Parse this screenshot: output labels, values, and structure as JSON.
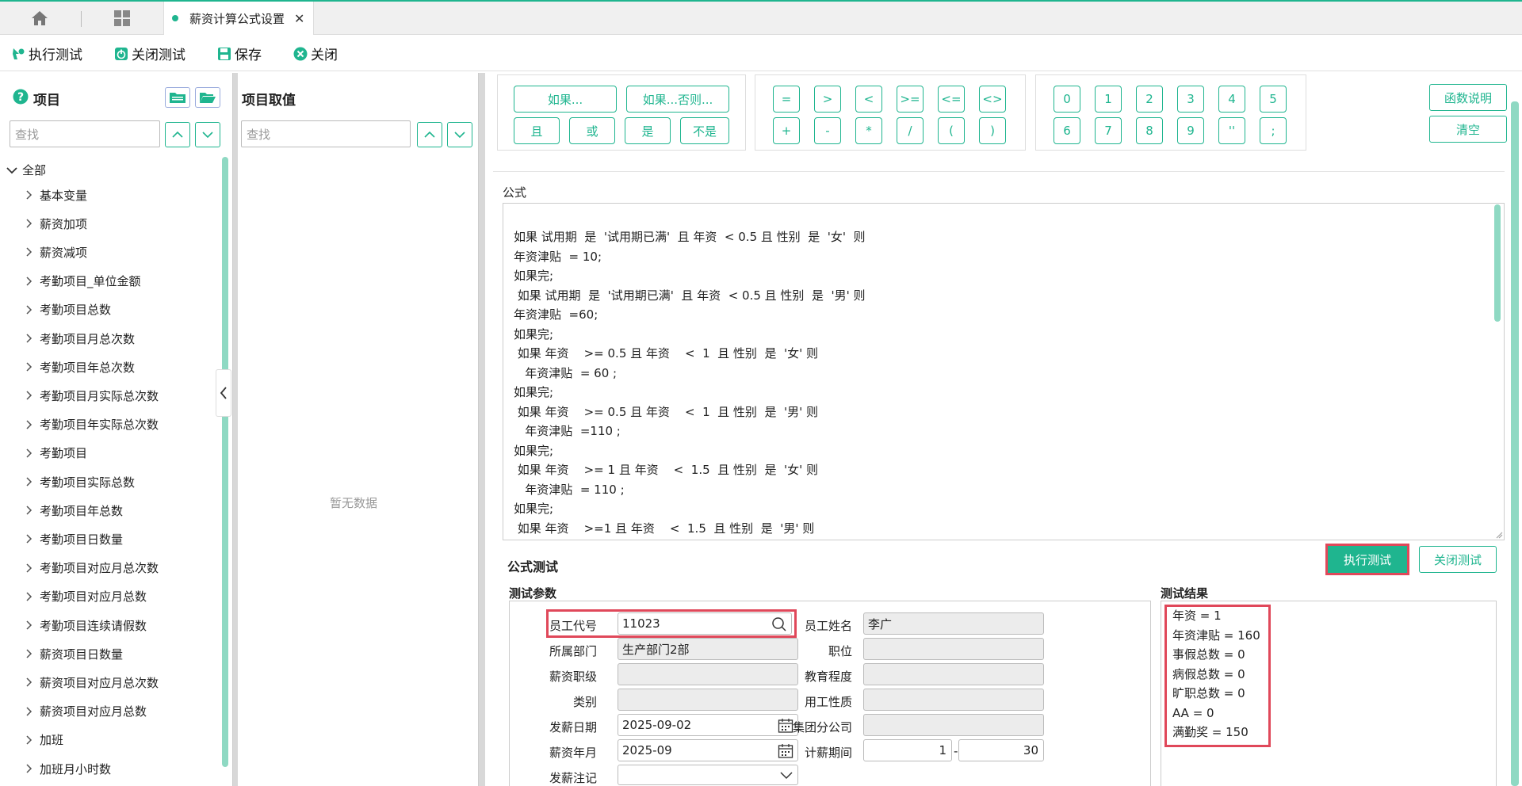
{
  "tabbar": {
    "active_tab": "薪资计算公式设置",
    "close": "✕"
  },
  "toolbar": {
    "exec_test": "执行测试",
    "close_test": "关闭测试",
    "save": "保存",
    "close": "关闭"
  },
  "left": {
    "title": "项目",
    "search_placeholder": "查找",
    "root": "全部",
    "items": [
      "基本变量",
      "薪资加项",
      "薪资减项",
      "考勤项目_单位金额",
      "考勤项目总数",
      "考勤项目月总次数",
      "考勤项目年总次数",
      "考勤项目月实际总次数",
      "考勤项目年实际总次数",
      "考勤项目",
      "考勤项目实际总数",
      "考勤项目年总数",
      "考勤项目日数量",
      "考勤项目对应月总次数",
      "考勤项目对应月总数",
      "考勤项目连续请假数",
      "薪资项目日数量",
      "薪资项目对应月总次数",
      "薪资项目对应月总数",
      "加班",
      "加班月小时数"
    ]
  },
  "middle": {
    "title": "项目取值",
    "search_placeholder": "查找",
    "empty": "暂无数据"
  },
  "ops": {
    "logic": [
      "如果...",
      "如果...否则...",
      "且",
      "或",
      "是",
      "不是"
    ],
    "compare": [
      "=",
      ">",
      "<",
      ">=",
      "<=",
      "<>",
      "+",
      "-",
      "*",
      "/",
      "(",
      ")"
    ],
    "digits": [
      "0",
      "1",
      "2",
      "3",
      "4",
      "5",
      "6",
      "7",
      "8",
      "9",
      "''",
      ";"
    ],
    "func_desc": "函数说明",
    "clear": "清空"
  },
  "formula": {
    "label": "公式",
    "lines": [
      "如果 试用期  是  '试用期已满'  且 年资  < 0.5 且 性别  是  '女'  则",
      "年资津贴  = 10;",
      "如果完;",
      " 如果 试用期  是  '试用期已满'  且 年资  < 0.5 且 性别  是  '男' 则",
      "年资津贴  =60;",
      "如果完;",
      " 如果 年资    >= 0.5 且 年资    <  1  且 性别  是  '女' 则",
      "   年资津贴  = 60 ;",
      "如果完;",
      " 如果 年资    >= 0.5 且 年资    <  1  且 性别  是  '男' 则",
      "   年资津贴  =110 ;",
      "如果完;",
      " 如果 年资    >= 1 且 年资    <  1.5  且 性别  是  '女' 则",
      "   年资津贴  = 110 ;",
      "如果完;",
      " 如果 年资    >=1 且 年资    <  1.5  且 性别  是  '男' 则"
    ]
  },
  "test": {
    "title": "公式测试",
    "exec": "执行测试",
    "close": "关闭测试",
    "params_title": "测试参数",
    "results_title": "测试结果",
    "fields": {
      "emp_code_label": "员工代号",
      "emp_code": "11023",
      "emp_name_label": "员工姓名",
      "emp_name": "李广",
      "dept_label": "所属部门",
      "dept": "生产部门2部",
      "position_label": "职位",
      "position": "",
      "grade_label": "薪资职级",
      "grade": "",
      "edu_label": "教育程度",
      "edu": "",
      "category_label": "类别",
      "category": "",
      "worktype_label": "用工性质",
      "worktype": "",
      "paydate_label": "发薪日期",
      "paydate": "2025-09-02",
      "branch_label": "集团分公司",
      "branch": "",
      "paymonth_label": "薪资年月",
      "paymonth": "2025-09",
      "period_label": "计薪期间",
      "period_from": "1",
      "period_sep": "-",
      "period_to": "30",
      "paynote_label": "发薪注记",
      "paynote": ""
    },
    "results": [
      "年资 = 1",
      "年资津贴 = 160",
      "事假总数 = 0",
      "病假总数 = 0",
      "旷职总数 = 0",
      "AA = 0",
      "满勤奖 = 150"
    ]
  },
  "colors": {
    "accent": "#1fb58f",
    "highlight": "#e0485a"
  }
}
